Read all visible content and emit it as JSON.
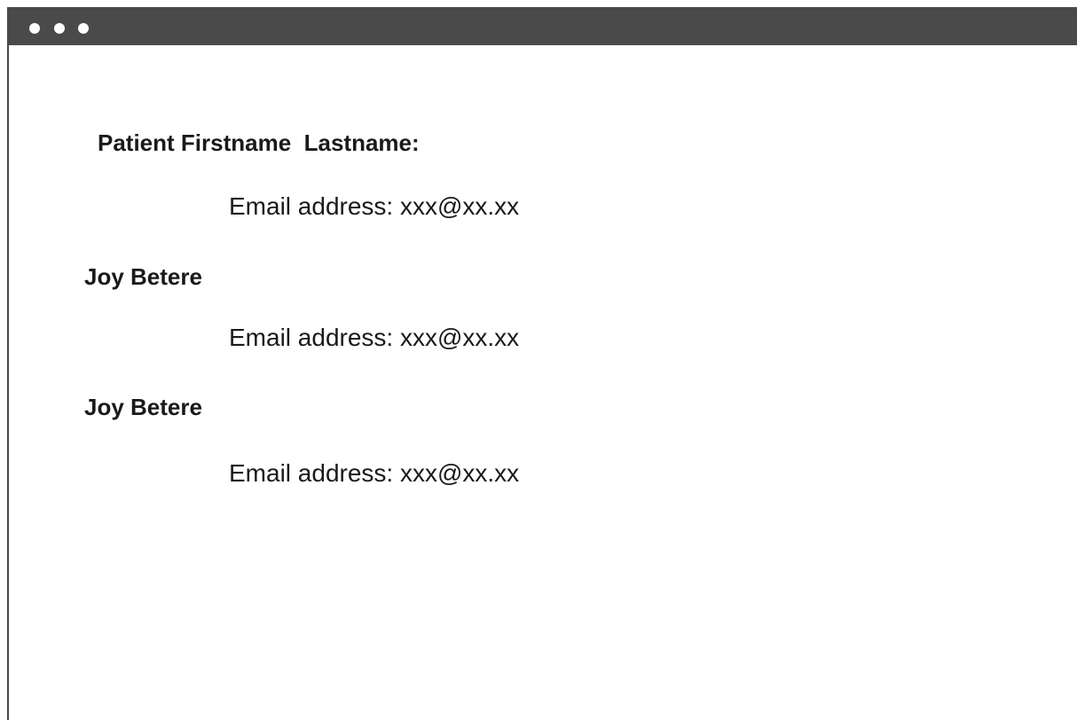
{
  "header": {
    "title": "Patient Firstname  Lastname:",
    "email_label": "Email address:",
    "email_value": "xxx@xx.xx"
  },
  "patients": [
    {
      "name": "Joy Betere",
      "email_label": "Email address:",
      "email_value": "xxx@xx.xx"
    },
    {
      "name": "Joy Betere",
      "email_label": "Email address:",
      "email_value": "xxx@xx.xx"
    }
  ]
}
